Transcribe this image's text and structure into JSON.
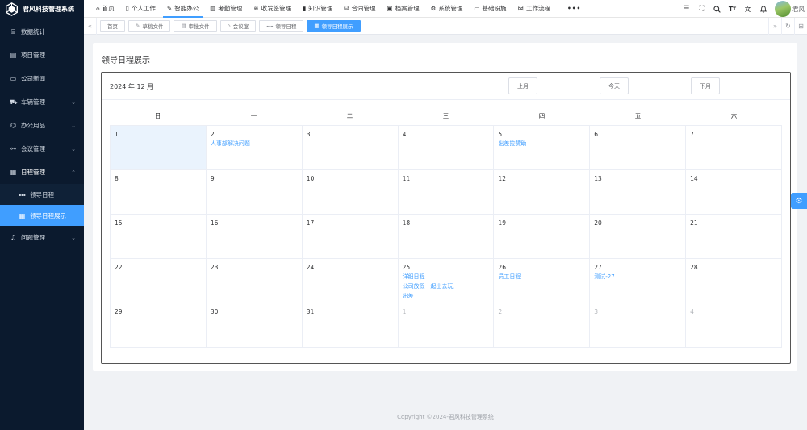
{
  "app": {
    "title": "君风科技管理系统",
    "brand_color": "#0b1a2e",
    "accent_color": "#409eff"
  },
  "sidebar": {
    "items": [
      {
        "label": "数据统计",
        "icon": "chart-icon"
      },
      {
        "label": "项目管理",
        "icon": "document-icon"
      },
      {
        "label": "公司新闻",
        "icon": "news-icon"
      },
      {
        "label": "车辆管理",
        "icon": "car-icon",
        "chevron": "⌄"
      },
      {
        "label": "办公用品",
        "icon": "tag-icon",
        "chevron": "⌄"
      },
      {
        "label": "会议管理",
        "icon": "meeting-icon",
        "chevron": "⌄"
      },
      {
        "label": "日程管理",
        "icon": "calendar-icon",
        "chevron": "⌃"
      },
      {
        "label": "问题管理",
        "icon": "bell-icon",
        "chevron": "⌄"
      }
    ],
    "submenu": [
      {
        "label": "领导日程",
        "icon": "dots-icon"
      },
      {
        "label": "领导日程展示",
        "icon": "calendar-icon"
      }
    ]
  },
  "topnav": {
    "items": [
      {
        "label": "首页",
        "icon": "home-icon"
      },
      {
        "label": "个人工作",
        "icon": "clipboard-icon"
      },
      {
        "label": "智能办公",
        "icon": "edit-icon"
      },
      {
        "label": "考勤管理",
        "icon": "bar-chart-icon"
      },
      {
        "label": "收发签管理",
        "icon": "stack-icon"
      },
      {
        "label": "知识管理",
        "icon": "book-icon"
      },
      {
        "label": "合同管理",
        "icon": "database-icon"
      },
      {
        "label": "档案管理",
        "icon": "archive-icon"
      },
      {
        "label": "系统管理",
        "icon": "gear-icon"
      },
      {
        "label": "基础设施",
        "icon": "monitor-icon"
      },
      {
        "label": "工作流程",
        "icon": "workflow-icon"
      }
    ],
    "more": "•••",
    "user_name": "君风"
  },
  "tags": [
    {
      "label": "首页",
      "icon": ""
    },
    {
      "label": "草稿文件",
      "icon": "edit-icon"
    },
    {
      "label": "审批文件",
      "icon": "document-icon"
    },
    {
      "label": "会议室",
      "icon": "home-icon"
    },
    {
      "label": "领导日程",
      "icon": "dots-icon"
    },
    {
      "label": "领导日程展示",
      "icon": "calendar-icon"
    }
  ],
  "page": {
    "title": "领导日程展示"
  },
  "calendar": {
    "month_label": "2024 年 12 月",
    "prev_label": "上月",
    "today_label": "今天",
    "next_label": "下月",
    "weekdays": [
      "日",
      "一",
      "二",
      "三",
      "四",
      "五",
      "六"
    ],
    "selected_day": "1",
    "weeks": [
      [
        {
          "d": "1",
          "events": []
        },
        {
          "d": "2",
          "events": [
            "人事部解决问题"
          ]
        },
        {
          "d": "3",
          "events": []
        },
        {
          "d": "4",
          "events": []
        },
        {
          "d": "5",
          "events": [
            "出差拉赞助"
          ]
        },
        {
          "d": "6",
          "events": []
        },
        {
          "d": "7",
          "events": []
        }
      ],
      [
        {
          "d": "8",
          "events": []
        },
        {
          "d": "9",
          "events": []
        },
        {
          "d": "10",
          "events": []
        },
        {
          "d": "11",
          "events": []
        },
        {
          "d": "12",
          "events": []
        },
        {
          "d": "13",
          "events": []
        },
        {
          "d": "14",
          "events": []
        }
      ],
      [
        {
          "d": "15",
          "events": []
        },
        {
          "d": "16",
          "events": []
        },
        {
          "d": "17",
          "events": []
        },
        {
          "d": "18",
          "events": []
        },
        {
          "d": "19",
          "events": []
        },
        {
          "d": "20",
          "events": []
        },
        {
          "d": "21",
          "events": []
        }
      ],
      [
        {
          "d": "22",
          "events": []
        },
        {
          "d": "23",
          "events": []
        },
        {
          "d": "24",
          "events": []
        },
        {
          "d": "25",
          "events": [
            "详细日程",
            "公司放假一起出去玩",
            "出差"
          ]
        },
        {
          "d": "26",
          "events": [
            "员工日程"
          ]
        },
        {
          "d": "27",
          "events": [
            "测试-27"
          ]
        },
        {
          "d": "28",
          "events": []
        }
      ],
      [
        {
          "d": "29",
          "events": []
        },
        {
          "d": "30",
          "events": []
        },
        {
          "d": "31",
          "events": []
        },
        {
          "d": "1",
          "events": [],
          "other": true
        },
        {
          "d": "2",
          "events": [],
          "other": true
        },
        {
          "d": "3",
          "events": [],
          "other": true
        },
        {
          "d": "4",
          "events": [],
          "other": true
        }
      ]
    ]
  },
  "footer": {
    "text": "Copyright ©2024-君风科技管理系统"
  }
}
